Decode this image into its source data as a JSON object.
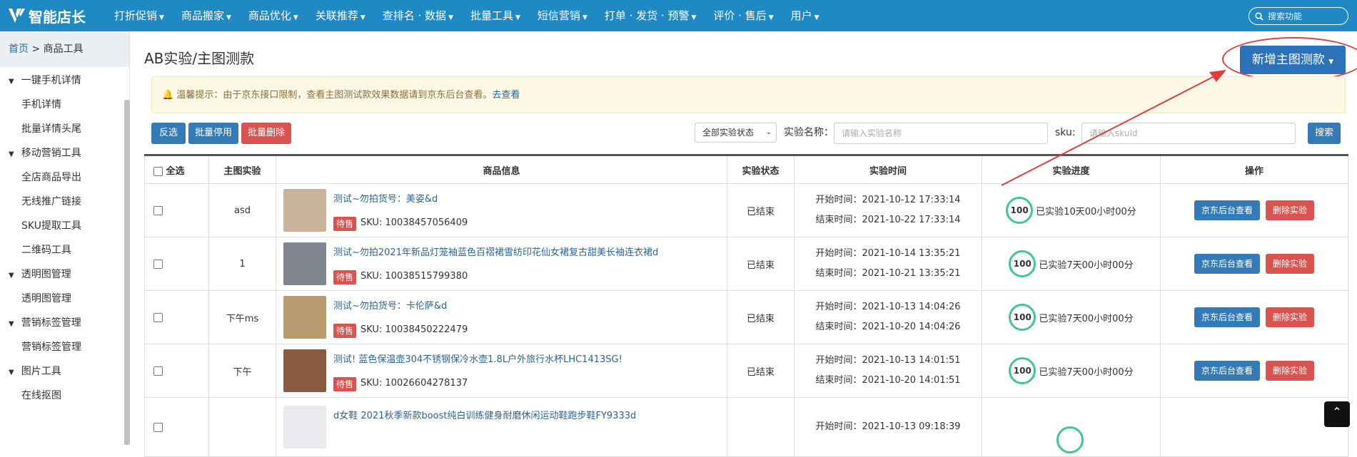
{
  "app": {
    "name": "智能店长"
  },
  "nav": [
    {
      "label": "打折促销"
    },
    {
      "label": "商品搬家"
    },
    {
      "label": "商品优化"
    },
    {
      "label": "关联推荐"
    },
    {
      "label": "查排名 · 数据"
    },
    {
      "label": "批量工具"
    },
    {
      "label": "短信营销"
    },
    {
      "label": "打单 · 发货 · 预警"
    },
    {
      "label": "评价 · 售后"
    },
    {
      "label": "用户"
    }
  ],
  "search": {
    "placeholder": "搜索功能"
  },
  "breadcrumb": {
    "home": "首页",
    "sep": " > ",
    "current": "商品工具"
  },
  "sidebar": {
    "groups": [
      {
        "label": "一键手机详情",
        "items": [
          "手机详情",
          "批量详情头尾"
        ]
      },
      {
        "label": "移动营销工具",
        "items": [
          "全店商品导出",
          "无线推广链接",
          "SKU提取工具",
          "二维码工具"
        ]
      },
      {
        "label": "透明图管理",
        "items": [
          "透明图管理"
        ]
      },
      {
        "label": "营销标签管理",
        "items": [
          "营销标签管理"
        ]
      },
      {
        "label": "图片工具",
        "items": [
          "在线抠图"
        ]
      }
    ]
  },
  "page": {
    "title": "AB实验/主图测款",
    "add_button": "新增主图测款"
  },
  "notice": {
    "text": "温馨提示：由于京东接口限制，查看主图测试款效果数据请到京东后台查看。",
    "link": "去查看"
  },
  "toolbar": {
    "invert": "反选",
    "batch_disable": "批量停用",
    "batch_delete": "批量删除",
    "status_select": "全部实验状态",
    "name_label": "实验名称：",
    "name_placeholder": "请输入实验名称",
    "sku_label": "sku:",
    "sku_placeholder": "请输入skuId",
    "search": "搜索"
  },
  "table": {
    "headers": {
      "select_all": "全选",
      "experiment": "主图实验",
      "goods": "商品信息",
      "status": "实验状态",
      "time": "实验时间",
      "progress": "实验进度",
      "ops": "操作"
    },
    "rows": [
      {
        "experiment": "asd",
        "title": "测试~勿拍货号：美姿&d",
        "tag": "待售",
        "sku": "SKU: 10038457056409",
        "status": "已结束",
        "start": "开始时间：2021-10-12 17:33:14",
        "end": "结束时间：2021-10-22 17:33:14",
        "progress": "100",
        "progress_text": "已实验10天00小时00分",
        "btn_view": "京东后台查看",
        "btn_delete": "删除实验",
        "thumb_color": "#c9b49b"
      },
      {
        "experiment": "1",
        "title": "测试~勿拍2021年新品灯笼袖蓝色百褶裙雪纺印花仙女裙复古甜美长袖连衣裙d",
        "tag": "待售",
        "sku": "SKU: 10038515799380",
        "status": "已结束",
        "start": "开始时间：2021-10-14 13:35:21",
        "end": "结束时间：2021-10-21 13:35:21",
        "progress": "100",
        "progress_text": "已实验7天00小时00分",
        "btn_view": "京东后台查看",
        "btn_delete": "删除实验",
        "thumb_color": "#7f8690"
      },
      {
        "experiment": "下午ms",
        "title": "测试~勿拍货号：卡伦萨&d",
        "tag": "待售",
        "sku": "SKU: 10038450222479",
        "status": "已结束",
        "start": "开始时间：2021-10-13 14:04:26",
        "end": "结束时间：2021-10-20 14:04:26",
        "progress": "100",
        "progress_text": "已实验7天00小时00分",
        "btn_view": "京东后台查看",
        "btn_delete": "删除实验",
        "thumb_color": "#b79a6e"
      },
      {
        "experiment": "下午",
        "title": "测试! 蓝色保温壶304不锈钢保冷水壶1.8L户外旅行水杯LHC1413SG!",
        "tag": "待售",
        "sku": "SKU: 10026604278137",
        "status": "已结束",
        "start": "开始时间：2021-10-13 14:01:51",
        "end": "结束时间：2021-10-20 14:01:51",
        "progress": "100",
        "progress_text": "已实验7天00小时00分",
        "btn_view": "京东后台查看",
        "btn_delete": "删除实验",
        "thumb_color": "#8a5a40"
      },
      {
        "experiment": "",
        "title": "d女鞋 2021秋季新款boost纯白训练健身耐磨休闲运动鞋跑步鞋FY9333d",
        "tag": "",
        "sku": "",
        "status": "",
        "start": "开始时间：2021-10-13 09:18:39",
        "end": "",
        "progress": "",
        "progress_text": "",
        "btn_view": "",
        "btn_delete": "",
        "thumb_color": "#e8eaed"
      }
    ]
  },
  "colors": {
    "topbar": "#1e89c3",
    "primary": "#337ab7",
    "danger": "#d9534f",
    "progress_ring": "#3cc88e",
    "annotation": "#e43c3c"
  }
}
